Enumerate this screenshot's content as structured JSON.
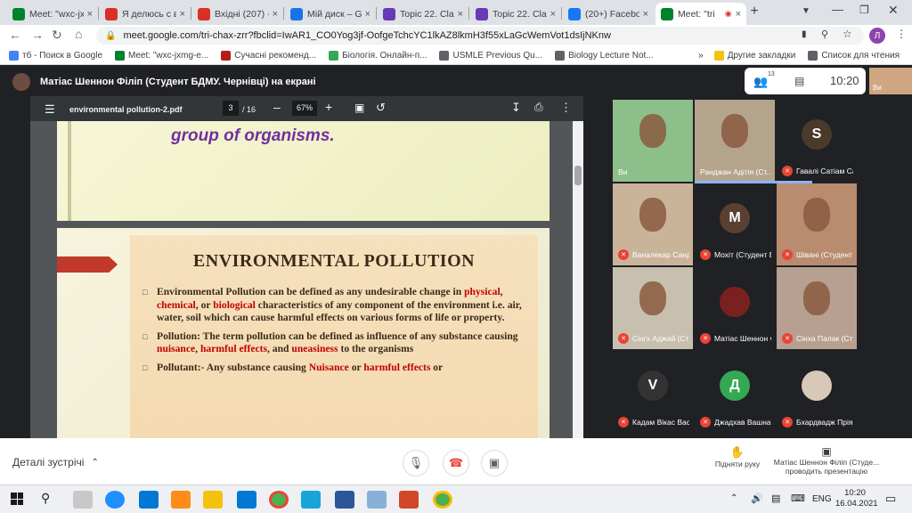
{
  "tabs": [
    {
      "title": "Meet: \"wxc-jx",
      "icon": "meet-icon",
      "color": "#00832d"
    },
    {
      "title": "Я делюсь с ва",
      "icon": "gmail-icon",
      "color": "#d93025"
    },
    {
      "title": "Вхідні (207) -",
      "icon": "gmail-icon",
      "color": "#d93025"
    },
    {
      "title": "Мій диск – G",
      "icon": "drive-icon",
      "color": "#1a73e8"
    },
    {
      "title": "Topic 22. Clas",
      "icon": "forms-icon",
      "color": "#673ab7"
    },
    {
      "title": "Topic 22. Clas",
      "icon": "forms-icon",
      "color": "#673ab7"
    },
    {
      "title": "(20+) Facebo",
      "icon": "facebook-icon",
      "color": "#1877f2"
    },
    {
      "title": "Meet: \"tri",
      "icon": "meet-icon",
      "color": "#00832d"
    }
  ],
  "new_tab": "+",
  "url": "meet.google.com/tri-chax-zrr?fbclid=IwAR1_CO0Yog3jf-OofgeTchcYC1lkAZ8lkmH3f55xLaGcWemVot1dsIjNKnw",
  "profile": "Л",
  "bookmarks": [
    {
      "label": "тб - Поиск в Google",
      "color": "#4285f4"
    },
    {
      "label": "Meet: \"wxc-jxmg-e...",
      "color": "#00832d"
    },
    {
      "label": "Сучасні рекоменд...",
      "color": "#b71c1c"
    },
    {
      "label": "Біологія. Онлайн-п...",
      "color": "#34a853"
    },
    {
      "label": "USMLE Previous Qu...",
      "color": "#5f6368"
    },
    {
      "label": "Biology Lecture Not...",
      "color": "#5f6368"
    }
  ],
  "bookmarks_more": "»",
  "bookmarks_other": "Другие закладки",
  "bookmarks_reading": "Список для чтения",
  "presenter_title": "Матіас Шеннон Філіп (Студент БДМУ. Чернівці) на екрані",
  "participants_count": "13",
  "clock": "10:20",
  "self_label": "Ви",
  "pdf": {
    "filename": "environmental pollution-2.pdf",
    "page": "3",
    "total": "/ 16",
    "zoom": "67%"
  },
  "slide": {
    "top_text": "group of organisms.",
    "heading": "ENVIRONMENTAL POLLUTION",
    "bullets": [
      [
        {
          "t": "Environmental Pollution can be defined as any undesirable change in "
        },
        {
          "t": "physical",
          "r": true
        },
        {
          "t": ", "
        },
        {
          "t": "chemical",
          "r": true
        },
        {
          "t": ", or "
        },
        {
          "t": "biological",
          "r": true
        },
        {
          "t": " characteristics of any component of the environment i.e. air, water, soil which can cause harmful effects on various forms of life or property."
        }
      ],
      [
        {
          "t": "Pollution: The term pollution can be defined as influence of any substance causing "
        },
        {
          "t": "nuisance",
          "r": true
        },
        {
          "t": ", "
        },
        {
          "t": "harmful effects",
          "r": true
        },
        {
          "t": ", and "
        },
        {
          "t": "uneasiness",
          "r": true
        },
        {
          "t": " to the organisms"
        }
      ],
      [
        {
          "t": "Pollutant:- Any substance causing "
        },
        {
          "t": "Nuisance",
          "r": true
        },
        {
          "t": " or "
        },
        {
          "t": "harmful effects",
          "r": true
        },
        {
          "t": " or"
        }
      ]
    ]
  },
  "participants": [
    {
      "name": "Ви",
      "type": "video",
      "bg": "#8dbf8a",
      "muted": false
    },
    {
      "name": "Ранджан Адітія (Ст...",
      "type": "video",
      "bg": "#b5a48c",
      "muted": false
    },
    {
      "name": "Гавалі Сатіам Сам...",
      "type": "avatar",
      "letter": "S",
      "bg": "#4a3a2a",
      "muted": true
    },
    {
      "name": "Ваналекар Санджі...",
      "type": "video",
      "bg": "#c9b49a",
      "muted": true
    },
    {
      "name": "Мохіт (Студент БД...",
      "type": "avatar",
      "letter": "M",
      "bg": "#5a4030",
      "muted": true
    },
    {
      "name": "Шівані (Студент Б...",
      "type": "video",
      "bg": "#b98c70",
      "muted": true
    },
    {
      "name": "Сінгх Аджай (Студ...",
      "type": "video",
      "bg": "#c8c0ae",
      "muted": true
    },
    {
      "name": "Матіас Шеннон Фі...",
      "type": "avatar",
      "letter": "",
      "bg": "#7a2020",
      "muted": true
    },
    {
      "name": "Сінха Палак (Студе...",
      "type": "video",
      "bg": "#b8a090",
      "muted": true
    },
    {
      "name": "Кадам Вікас Васан...",
      "type": "avatar",
      "letter": "V",
      "bg": "#333333",
      "muted": true
    },
    {
      "name": "Джадхав Вашнаві ...",
      "type": "avatar",
      "letter": "Д",
      "bg": "#34a853",
      "muted": true
    },
    {
      "name": "Бхардвадж Пріянк...",
      "type": "avatar",
      "letter": "",
      "bg": "#d8c8b8",
      "muted": true
    }
  ],
  "bottom": {
    "details": "Деталі зустрічі",
    "raise_hand": "Підняти руку",
    "presenter_line1": "Матіас Шеннон Філіп (Студе...",
    "presenter_line2": "проводить презентацію"
  },
  "taskbar": {
    "lang": "ENG",
    "time": "10:20",
    "date": "16.04.2021"
  }
}
